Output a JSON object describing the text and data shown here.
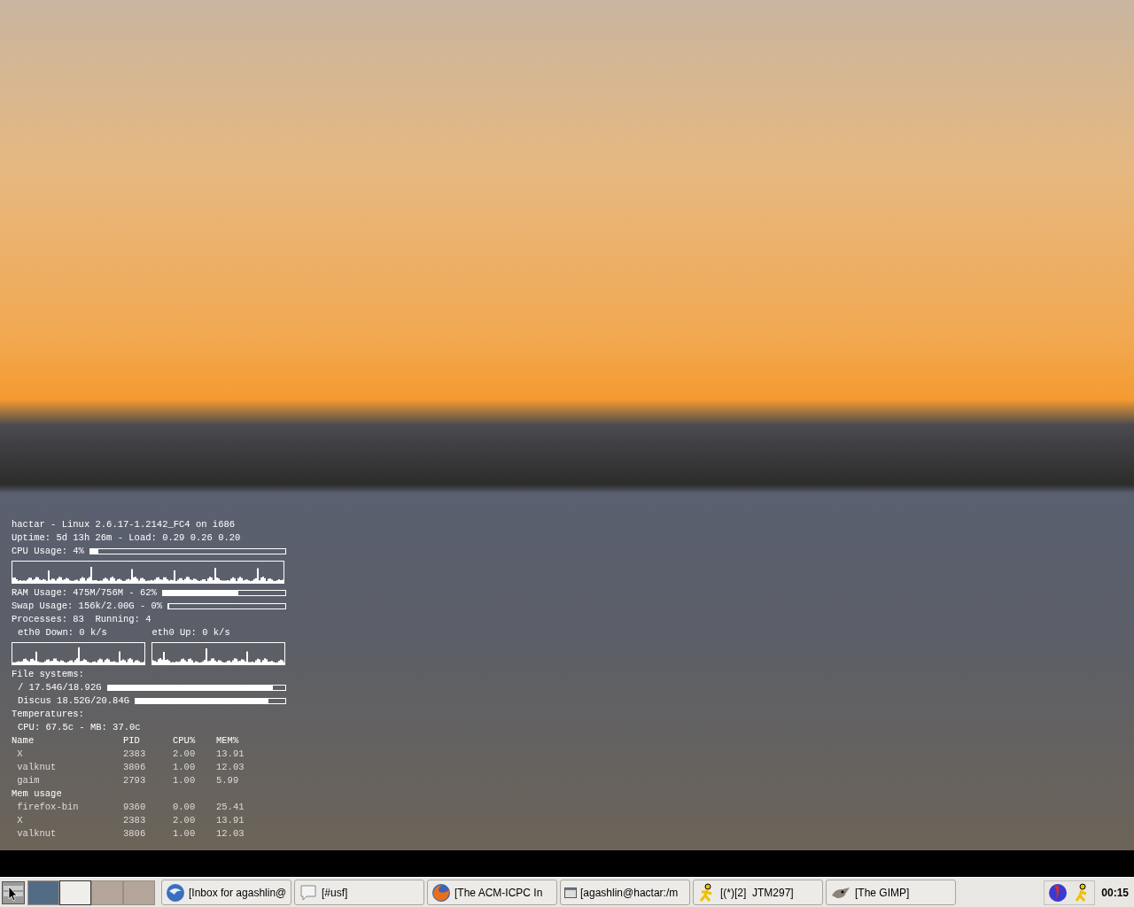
{
  "conky": {
    "lines": [
      "hactar - Linux 2.6.17-1.2142_FC4 on i686",
      "Uptime: 5d 13h 26m - Load: 0.29 0.26 0.20"
    ],
    "cpu": {
      "label": "CPU Usage: 4%",
      "level": 0.04
    },
    "ram": {
      "label": "RAM Usage: 475M/756M - 62%",
      "level": 0.62
    },
    "swap": {
      "label": "Swap Usage: 156k/2.00G - 0%",
      "level": 0.0
    },
    "processes": "Processes: 83  Running: 4",
    "net": {
      "down": "eth0 Down: 0 k/s",
      "up": "eth0 Up: 0 k/s"
    },
    "filesystems_title": "File systems:",
    "filesystems": [
      {
        "label": "/ 17.54G/18.92G",
        "level": 0.93
      },
      {
        "label": "Discus 18.52G/20.84G",
        "level": 0.89
      }
    ],
    "temperatures_title": "Temperatures:",
    "temperatures": "CPU: 67.5c - MB: 37.0c",
    "top_cpu": {
      "columns": [
        "Name",
        "PID",
        "CPU%",
        "MEM%"
      ],
      "rows": [
        [
          "X",
          "2383",
          "2.00",
          "13.91"
        ],
        [
          "valknut",
          "3806",
          "1.00",
          "12.03"
        ],
        [
          "gaim",
          "2793",
          "1.00",
          "5.99"
        ]
      ]
    },
    "mem_title": "Mem usage",
    "top_mem": {
      "rows": [
        [
          "firefox-bin",
          "9360",
          "0.00",
          "25.41"
        ],
        [
          "X",
          "2383",
          "2.00",
          "13.91"
        ],
        [
          "valknut",
          "3806",
          "1.00",
          "12.03"
        ]
      ]
    }
  },
  "taskbar": {
    "pager": [
      {
        "selected": true
      },
      {
        "selected": false
      },
      {
        "selected": false
      },
      {
        "selected": false
      }
    ],
    "tasks": [
      {
        "kind": "mail",
        "label": "[Inbox for agashlin@"
      },
      {
        "kind": "irc",
        "label": "[#usf]"
      },
      {
        "kind": "browser",
        "label": "[The ACM-ICPC In"
      },
      {
        "kind": "terminal",
        "label": "[agashlin@hactar:/m"
      },
      {
        "kind": "chat",
        "label": "[(*)[2]  JTM297]"
      },
      {
        "kind": "gimp",
        "label": "[The GIMP]"
      }
    ],
    "clock": "00:15"
  }
}
